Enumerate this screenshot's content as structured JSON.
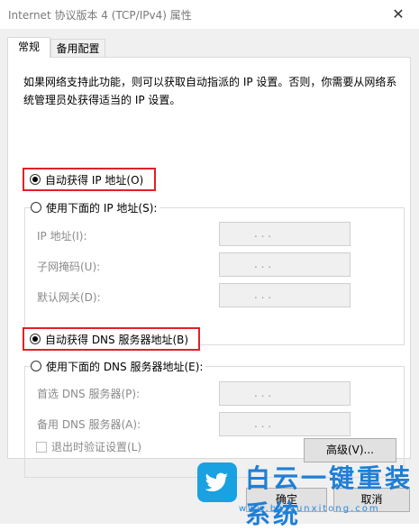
{
  "window": {
    "title": "Internet 协议版本 4 (TCP/IPv4) 属性",
    "close_glyph": "✕"
  },
  "tabs": [
    {
      "label": "常规",
      "active": true
    },
    {
      "label": "备用配置",
      "active": false
    }
  ],
  "description": "如果网络支持此功能，则可以获取自动指派的 IP 设置。否则，你需要从网络系统管理员处获得适当的 IP 设置。",
  "ip_section": {
    "auto_label": "自动获得 IP 地址(O)",
    "auto_selected": true,
    "manual_label": "使用下面的 IP 地址(S):",
    "fields": [
      {
        "label": "IP 地址(I):",
        "value": ".   .   ."
      },
      {
        "label": "子网掩码(U):",
        "value": ".   .   ."
      },
      {
        "label": "默认网关(D):",
        "value": ".   .   ."
      }
    ]
  },
  "dns_section": {
    "auto_label": "自动获得 DNS 服务器地址(B)",
    "auto_selected": true,
    "manual_label": "使用下面的 DNS 服务器地址(E):",
    "fields": [
      {
        "label": "首选 DNS 服务器(P):",
        "value": ".   .   ."
      },
      {
        "label": "备用 DNS 服务器(A):",
        "value": ".   .   ."
      }
    ]
  },
  "validate_checkbox": {
    "label": "退出时验证设置(L)",
    "checked": false,
    "enabled": false
  },
  "buttons": {
    "advanced": "高级(V)...",
    "ok": "确定",
    "cancel": "取消"
  },
  "watermark": {
    "text": "白云一键重装系统",
    "url": "www.baiyunxitong.com",
    "icon": "twitter-bird-icon"
  },
  "colors": {
    "highlight_border": "#e0202a",
    "watermark_blue": "#1e7fd6"
  }
}
